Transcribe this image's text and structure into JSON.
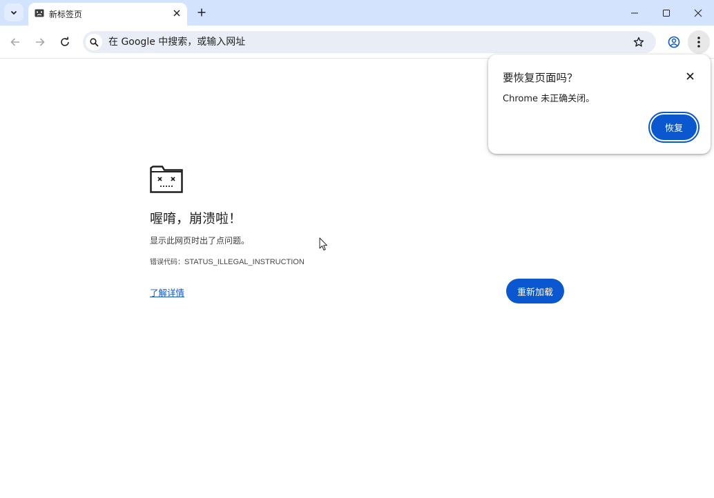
{
  "browser": {
    "tab": {
      "title": "新标签页",
      "favicon": "sad-face-icon"
    },
    "omnibox": {
      "placeholder": "在 Google 中搜索，或输入网址",
      "value": ""
    }
  },
  "error_page": {
    "icon": "sad-folder-icon",
    "title": "喔唷，崩溃啦！",
    "description": "显示此网页时出了点问题。",
    "code_label": "错误代码：",
    "code_value": "STATUS_ILLEGAL_INSTRUCTION",
    "learn_more": "了解详情",
    "reload_label": "重新加载"
  },
  "restore_popup": {
    "title": "要恢复页面吗？",
    "message": "Chrome 未正确关闭。",
    "restore_label": "恢复"
  },
  "colors": {
    "tabstrip_bg": "#d3e3fd",
    "accent": "#0b57d0",
    "omnibox_bg": "#e9eef6"
  }
}
